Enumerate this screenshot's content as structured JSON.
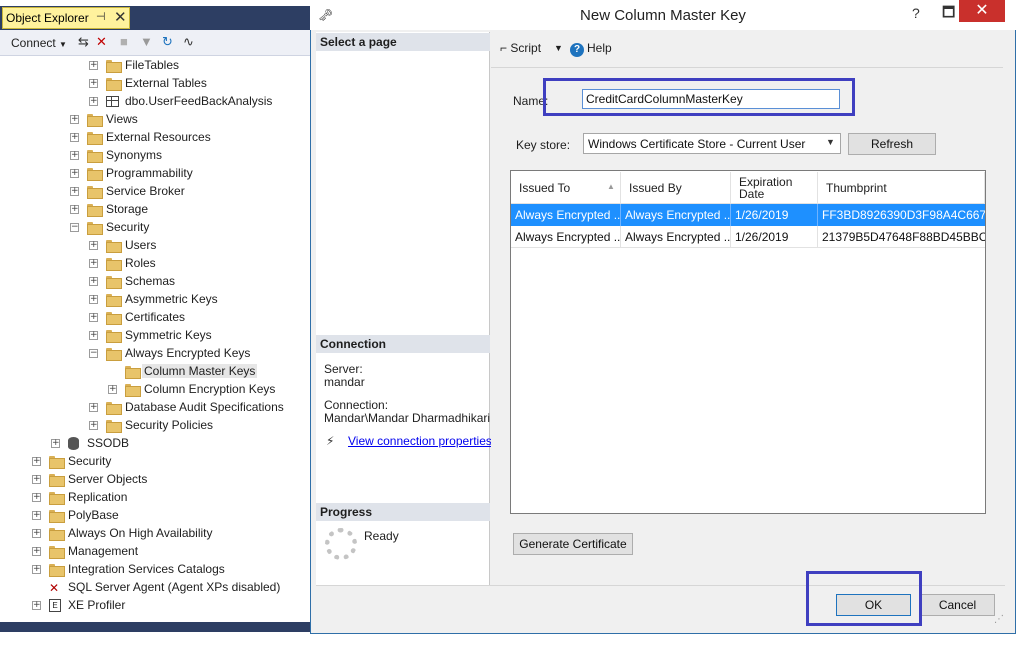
{
  "object_explorer": {
    "title": "Object Explorer",
    "pin_icon": "pin-icon",
    "close_glyph": "✕",
    "toolbar": {
      "connect_label": "Connect",
      "icons": [
        "connect-icon",
        "disconnect-icon",
        "stop-icon",
        "filter-icon",
        "refresh-icon",
        "activity-monitor-icon"
      ]
    },
    "tree": [
      {
        "label": "FileTables",
        "expander": "+"
      },
      {
        "label": "External Tables",
        "expander": "+"
      },
      {
        "label": "dbo.UserFeedBackAnalysis",
        "expander": "+"
      },
      {
        "label": "Views",
        "expander": "+"
      },
      {
        "label": "External Resources",
        "expander": "+"
      },
      {
        "label": "Synonyms",
        "expander": "+"
      },
      {
        "label": "Programmability",
        "expander": "+"
      },
      {
        "label": "Service Broker",
        "expander": "+"
      },
      {
        "label": "Storage",
        "expander": "+"
      },
      {
        "label": "Security",
        "expander": "−"
      },
      {
        "label": "Users",
        "expander": "+"
      },
      {
        "label": "Roles",
        "expander": "+"
      },
      {
        "label": "Schemas",
        "expander": "+"
      },
      {
        "label": "Asymmetric Keys",
        "expander": "+"
      },
      {
        "label": "Certificates",
        "expander": "+"
      },
      {
        "label": "Symmetric Keys",
        "expander": "+"
      },
      {
        "label": "Always Encrypted Keys",
        "expander": "−"
      },
      {
        "label": "Column Master Keys",
        "expander": ""
      },
      {
        "label": "Column Encryption Keys",
        "expander": "+"
      },
      {
        "label": "Database Audit Specifications",
        "expander": "+"
      },
      {
        "label": "Security Policies",
        "expander": "+"
      },
      {
        "label": "SSODB",
        "expander": "+"
      },
      {
        "label": "Security",
        "expander": "+"
      },
      {
        "label": "Server Objects",
        "expander": "+"
      },
      {
        "label": "Replication",
        "expander": "+"
      },
      {
        "label": "PolyBase",
        "expander": "+"
      },
      {
        "label": "Always On High Availability",
        "expander": "+"
      },
      {
        "label": "Management",
        "expander": "+"
      },
      {
        "label": "Integration Services Catalogs",
        "expander": "+"
      },
      {
        "label": "SQL Server Agent (Agent XPs disabled)",
        "expander": ""
      },
      {
        "label": "XE Profiler",
        "expander": "+"
      }
    ]
  },
  "dialog": {
    "title": "New Column Master Key",
    "title_buttons": {
      "help": "?",
      "minimize": "🗖",
      "close": "✕"
    },
    "left_pane": {
      "select_page_header": "Select a page",
      "connection_header": "Connection",
      "server_label": "Server:",
      "server_value": "mandar",
      "connection_label": "Connection:",
      "connection_value": "Mandar\\Mandar Dharmadhikari",
      "view_connection_link": "View connection properties",
      "progress_header": "Progress",
      "progress_status": "Ready"
    },
    "toolbar": {
      "script_label": "Script",
      "help_label": "Help"
    },
    "form": {
      "name_label": "Name:",
      "name_value": "CreditCardColumnMasterKey",
      "key_store_label": "Key store:",
      "key_store_value": "Windows Certificate Store - Current User",
      "refresh_label": "Refresh"
    },
    "grid": {
      "columns": [
        "Issued To",
        "Issued By",
        "Expiration Date",
        "Thumbprint"
      ],
      "rows": [
        {
          "issued_to": "Always Encrypted ...",
          "issued_by": "Always Encrypted ...",
          "expiration": "1/26/2019",
          "thumbprint": "FF3BD8926390D3F98A4C667...",
          "selected": true
        },
        {
          "issued_to": "Always Encrypted ...",
          "issued_by": "Always Encrypted ...",
          "expiration": "1/26/2019",
          "thumbprint": "21379B5D47648F88BD45BBC...",
          "selected": false
        }
      ]
    },
    "generate_certificate_label": "Generate Certificate",
    "ok_label": "OK",
    "cancel_label": "Cancel"
  },
  "colors": {
    "highlight_box": "#3f3fc0",
    "selected_row": "#1e90ff",
    "titlebar_dark": "#2d3e63",
    "tab_active": "#fff29d"
  }
}
